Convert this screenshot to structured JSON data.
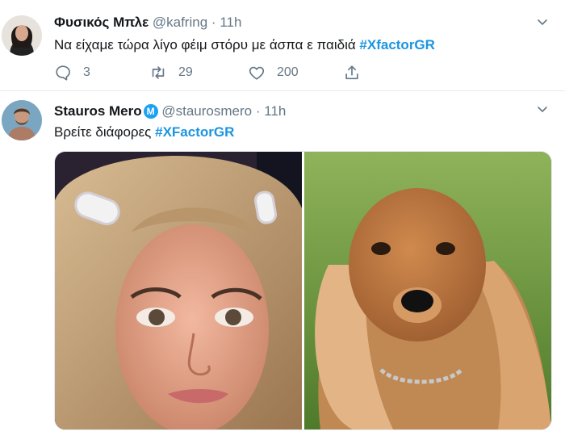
{
  "tweets": [
    {
      "display_name": "Φυσικός Μπλε",
      "handle": "@kafring",
      "separator": "·",
      "time": "11h",
      "text": "Να είχαμε τώρα λίγο φέιμ στόρυ με άσπα ε παιδιά",
      "hashtag": "#XfactorGR",
      "actions": {
        "reply_count": "3",
        "retweet_count": "29",
        "like_count": "200"
      }
    },
    {
      "display_name": "Stauros Mero",
      "verified_glyph": "M",
      "handle": "@staurosmero",
      "separator": "·",
      "time": "11h",
      "text": "Βρείτε διάφορες",
      "hashtag": "#XFactorGR",
      "media": [
        "woman-closeup-photo",
        "cocker-spaniel-photo"
      ]
    }
  ],
  "colors": {
    "link": "#1b95e0",
    "muted": "#657786",
    "text": "#14171a",
    "divider": "#e6ecf0"
  },
  "icons": [
    "reply-icon",
    "retweet-icon",
    "like-icon",
    "share-icon",
    "chevron-down-icon"
  ]
}
